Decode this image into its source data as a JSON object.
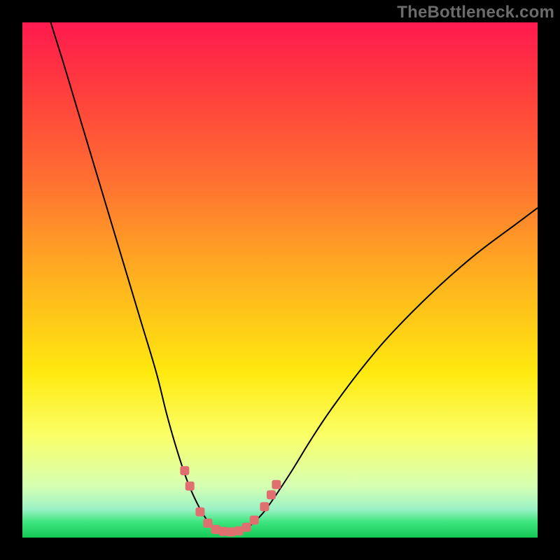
{
  "watermark": "TheBottleneck.com",
  "chart_data": {
    "type": "line",
    "title": "",
    "xlabel": "",
    "ylabel": "",
    "xlim": [
      0,
      100
    ],
    "ylim": [
      0,
      100
    ],
    "grid": false,
    "legend": false,
    "background_gradient_stops": [
      {
        "pos": 0.0,
        "color": "#ff1a4f"
      },
      {
        "pos": 0.12,
        "color": "#ff3a3e"
      },
      {
        "pos": 0.3,
        "color": "#ff6e32"
      },
      {
        "pos": 0.5,
        "color": "#ffb21f"
      },
      {
        "pos": 0.68,
        "color": "#ffe90f"
      },
      {
        "pos": 0.8,
        "color": "#fbff66"
      },
      {
        "pos": 0.9,
        "color": "#d6ffb3"
      },
      {
        "pos": 0.945,
        "color": "#9bf2c5"
      },
      {
        "pos": 0.97,
        "color": "#3de57e"
      },
      {
        "pos": 1.0,
        "color": "#14c956"
      }
    ],
    "series": [
      {
        "name": "bottleneck-curve-left",
        "type": "line",
        "color": "#000000",
        "points": [
          {
            "x": 5.5,
            "y": 100
          },
          {
            "x": 8,
            "y": 92
          },
          {
            "x": 11,
            "y": 82
          },
          {
            "x": 14,
            "y": 72
          },
          {
            "x": 17,
            "y": 62
          },
          {
            "x": 20,
            "y": 52
          },
          {
            "x": 23,
            "y": 42
          },
          {
            "x": 26,
            "y": 32
          },
          {
            "x": 28,
            "y": 24
          },
          {
            "x": 30,
            "y": 17
          },
          {
            "x": 32,
            "y": 11
          },
          {
            "x": 34,
            "y": 6.5
          },
          {
            "x": 36,
            "y": 3.2
          },
          {
            "x": 38,
            "y": 1.6
          },
          {
            "x": 40,
            "y": 1.0
          }
        ]
      },
      {
        "name": "bottleneck-curve-right",
        "type": "line",
        "color": "#000000",
        "points": [
          {
            "x": 40,
            "y": 1.0
          },
          {
            "x": 42,
            "y": 1.2
          },
          {
            "x": 44,
            "y": 2.2
          },
          {
            "x": 46,
            "y": 4.0
          },
          {
            "x": 48,
            "y": 6.5
          },
          {
            "x": 52,
            "y": 12.5
          },
          {
            "x": 56,
            "y": 19
          },
          {
            "x": 60,
            "y": 25
          },
          {
            "x": 66,
            "y": 33
          },
          {
            "x": 72,
            "y": 40
          },
          {
            "x": 80,
            "y": 48
          },
          {
            "x": 88,
            "y": 55
          },
          {
            "x": 96,
            "y": 61
          },
          {
            "x": 100,
            "y": 64
          }
        ]
      },
      {
        "name": "highlight-markers",
        "type": "scatter",
        "color": "#e07070",
        "points": [
          {
            "x": 31.5,
            "y": 13
          },
          {
            "x": 32.5,
            "y": 10
          },
          {
            "x": 34.5,
            "y": 5
          },
          {
            "x": 36,
            "y": 2.8
          },
          {
            "x": 37.5,
            "y": 1.6
          },
          {
            "x": 39,
            "y": 1.2
          },
          {
            "x": 40.5,
            "y": 1.1
          },
          {
            "x": 42,
            "y": 1.3
          },
          {
            "x": 43.5,
            "y": 2.0
          },
          {
            "x": 45,
            "y": 3.4
          },
          {
            "x": 47,
            "y": 6.0
          },
          {
            "x": 48.3,
            "y": 8.3
          },
          {
            "x": 49.3,
            "y": 10.3
          }
        ]
      }
    ]
  }
}
